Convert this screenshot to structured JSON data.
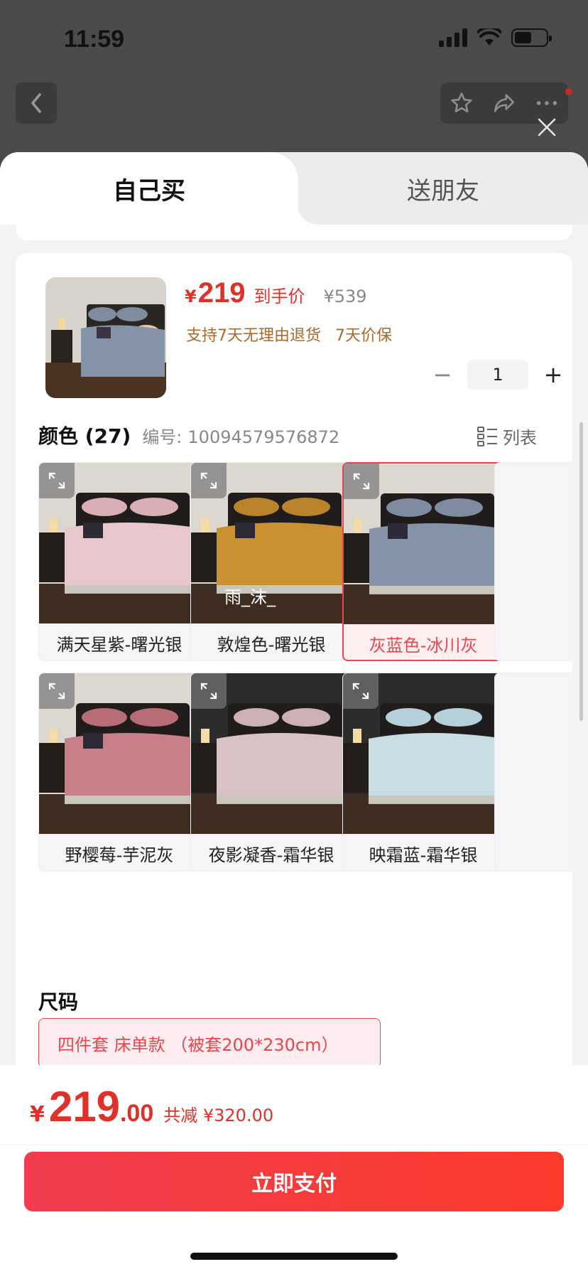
{
  "status_bar": {
    "time": "11:59"
  },
  "background_nav": {
    "back_icon": "chevron-left-icon",
    "tools": [
      "star-icon",
      "share-icon",
      "more-icon"
    ]
  },
  "sheet": {
    "tabs": [
      {
        "label": "自己买",
        "active": true
      },
      {
        "label": "送朋友",
        "active": false
      }
    ],
    "product": {
      "currency": "¥",
      "price": "219",
      "price_label": "到手价",
      "original_price": "¥539",
      "services": [
        "支持7天无理由退货",
        "7天价保"
      ],
      "quantity": "1",
      "minus": "−",
      "plus": "+"
    },
    "color": {
      "title": "颜色 (27)",
      "code_label": "编号:",
      "code": "10094579576872",
      "list_label": "列表",
      "watermark": "雨_沫_",
      "options": [
        {
          "label": "满天星紫-曙光银",
          "selected": false,
          "duvet": "#e7c7cb",
          "pillow": "#d9aeb4"
        },
        {
          "label": "敦煌色-曙光银",
          "selected": false,
          "duvet": "#c9912f",
          "pillow": "#b9832c"
        },
        {
          "label": "灰蓝色-冰川灰",
          "selected": true,
          "duvet": "#8593a8",
          "pillow": "#7f8ca0"
        },
        {
          "label": "野樱莓-芋泥灰",
          "selected": false,
          "duvet": "#c97f87",
          "pillow": "#b86c76"
        },
        {
          "label": "夜影凝香-霜华银",
          "selected": false,
          "duvet": "#d9c2c4",
          "pillow": "#ccb0b4"
        },
        {
          "label": "映霜蓝-霜华银",
          "selected": false,
          "duvet": "#c7dde3",
          "pillow": "#b5d0d8"
        }
      ]
    },
    "size": {
      "title": "尺码",
      "option": "四件套 床单款 （被套200*230cm）"
    }
  },
  "footer": {
    "currency": "¥",
    "total_int": "219",
    "total_dec": ".00",
    "savings": "共减 ¥320.00",
    "pay_button": "立即支付"
  },
  "colors": {
    "accent": "#e0302a",
    "selected_border": "#e8464c",
    "service_text": "#a8692c"
  }
}
